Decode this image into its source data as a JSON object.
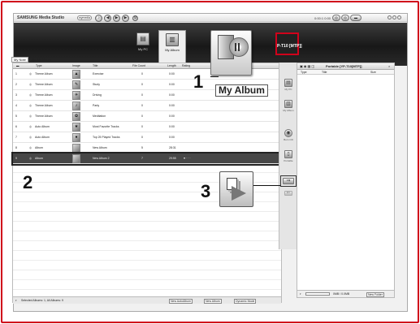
{
  "app": {
    "title": "SAMSUNG Media Studio",
    "mode": "mymedia",
    "time": "0:00:1 0:00",
    "window_controls": [
      "-",
      "□",
      "×"
    ]
  },
  "topbar": {
    "tiles": [
      {
        "label": "My PC",
        "icon": "pc-icon"
      },
      {
        "label": "My Album",
        "icon": "album-icon"
      }
    ],
    "portable_label": "P-T10 [MTP]]"
  },
  "breadcrumb": {
    "button": "My Note",
    "current": "My Album"
  },
  "table": {
    "columns": [
      "Type",
      "Image",
      "Title",
      "File Count",
      "Length",
      "Rating"
    ],
    "rows": [
      {
        "num": "1",
        "type": "Theme Album",
        "title": "Exercise",
        "count": "0",
        "length": "0:00",
        "thumb": "▲"
      },
      {
        "num": "2",
        "type": "Theme Album",
        "title": "Study",
        "count": "0",
        "length": "0:00",
        "thumb": "✎"
      },
      {
        "num": "3",
        "type": "Theme Album",
        "title": "Driving",
        "count": "0",
        "length": "0:00",
        "thumb": "✈"
      },
      {
        "num": "4",
        "type": "Theme Album",
        "title": "Party",
        "count": "0",
        "length": "0:00",
        "thumb": "♪"
      },
      {
        "num": "5",
        "type": "Theme Album",
        "title": "Meditation",
        "count": "0",
        "length": "0:00",
        "thumb": "✿"
      },
      {
        "num": "6",
        "type": "Auto Album",
        "title": "Most Favorite Tracks",
        "count": "0",
        "length": "0:00",
        "thumb": "★"
      },
      {
        "num": "7",
        "type": "Auto Album",
        "title": "Top 25 Played Tracks",
        "count": "0",
        "length": "0:00",
        "thumb": "●"
      },
      {
        "num": "8",
        "type": "Album",
        "title": "New Album",
        "count": "5",
        "length": "28:31",
        "thumb": ""
      },
      {
        "num": "9",
        "type": "Album",
        "title": "New Album 2",
        "count": "7",
        "length": "29:55",
        "thumb": ""
      }
    ],
    "status": "Selected Albums: 1, All Albums: 9",
    "footer_buttons": [
      "New AutoAlbum",
      "New Album",
      "Dynamic Mode"
    ]
  },
  "sidebar": {
    "items": [
      "My PC",
      "My Album",
      "Burn CD",
      "Portable"
    ]
  },
  "portable_panel": {
    "title": "Portable [YP-T10[MTP]]",
    "columns": [
      "Type",
      "Title",
      "Size"
    ],
    "capacity": "0MB / 0.0MB",
    "new_folder": "New Folder"
  },
  "callouts": {
    "one": "1",
    "two": "2",
    "three": "3",
    "my_album_caption": "My Album"
  }
}
